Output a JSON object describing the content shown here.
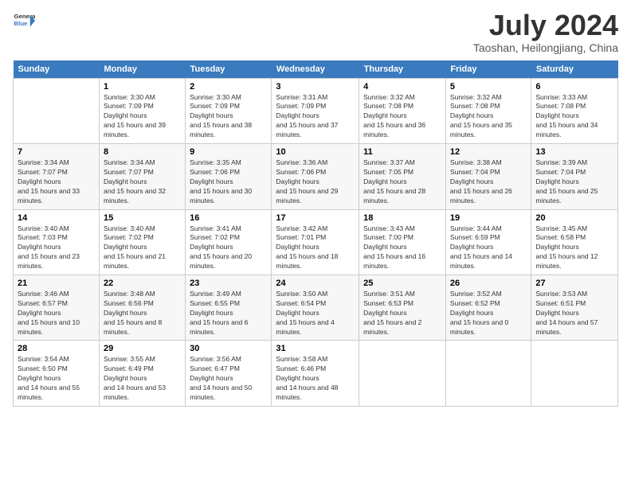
{
  "header": {
    "logo_line1": "General",
    "logo_line2": "Blue",
    "title": "July 2024",
    "subtitle": "Taoshan, Heilongjiang, China"
  },
  "weekdays": [
    "Sunday",
    "Monday",
    "Tuesday",
    "Wednesday",
    "Thursday",
    "Friday",
    "Saturday"
  ],
  "weeks": [
    [
      {
        "day": "",
        "sunrise": "",
        "sunset": "",
        "daylight": ""
      },
      {
        "day": "1",
        "sunrise": "3:30 AM",
        "sunset": "7:09 PM",
        "daylight": "15 hours and 39 minutes."
      },
      {
        "day": "2",
        "sunrise": "3:30 AM",
        "sunset": "7:09 PM",
        "daylight": "15 hours and 38 minutes."
      },
      {
        "day": "3",
        "sunrise": "3:31 AM",
        "sunset": "7:09 PM",
        "daylight": "15 hours and 37 minutes."
      },
      {
        "day": "4",
        "sunrise": "3:32 AM",
        "sunset": "7:08 PM",
        "daylight": "15 hours and 36 minutes."
      },
      {
        "day": "5",
        "sunrise": "3:32 AM",
        "sunset": "7:08 PM",
        "daylight": "15 hours and 35 minutes."
      },
      {
        "day": "6",
        "sunrise": "3:33 AM",
        "sunset": "7:08 PM",
        "daylight": "15 hours and 34 minutes."
      }
    ],
    [
      {
        "day": "7",
        "sunrise": "3:34 AM",
        "sunset": "7:07 PM",
        "daylight": "15 hours and 33 minutes."
      },
      {
        "day": "8",
        "sunrise": "3:34 AM",
        "sunset": "7:07 PM",
        "daylight": "15 hours and 32 minutes."
      },
      {
        "day": "9",
        "sunrise": "3:35 AM",
        "sunset": "7:06 PM",
        "daylight": "15 hours and 30 minutes."
      },
      {
        "day": "10",
        "sunrise": "3:36 AM",
        "sunset": "7:06 PM",
        "daylight": "15 hours and 29 minutes."
      },
      {
        "day": "11",
        "sunrise": "3:37 AM",
        "sunset": "7:05 PM",
        "daylight": "15 hours and 28 minutes."
      },
      {
        "day": "12",
        "sunrise": "3:38 AM",
        "sunset": "7:04 PM",
        "daylight": "15 hours and 26 minutes."
      },
      {
        "day": "13",
        "sunrise": "3:39 AM",
        "sunset": "7:04 PM",
        "daylight": "15 hours and 25 minutes."
      }
    ],
    [
      {
        "day": "14",
        "sunrise": "3:40 AM",
        "sunset": "7:03 PM",
        "daylight": "15 hours and 23 minutes."
      },
      {
        "day": "15",
        "sunrise": "3:40 AM",
        "sunset": "7:02 PM",
        "daylight": "15 hours and 21 minutes."
      },
      {
        "day": "16",
        "sunrise": "3:41 AM",
        "sunset": "7:02 PM",
        "daylight": "15 hours and 20 minutes."
      },
      {
        "day": "17",
        "sunrise": "3:42 AM",
        "sunset": "7:01 PM",
        "daylight": "15 hours and 18 minutes."
      },
      {
        "day": "18",
        "sunrise": "3:43 AM",
        "sunset": "7:00 PM",
        "daylight": "15 hours and 16 minutes."
      },
      {
        "day": "19",
        "sunrise": "3:44 AM",
        "sunset": "6:59 PM",
        "daylight": "15 hours and 14 minutes."
      },
      {
        "day": "20",
        "sunrise": "3:45 AM",
        "sunset": "6:58 PM",
        "daylight": "15 hours and 12 minutes."
      }
    ],
    [
      {
        "day": "21",
        "sunrise": "3:46 AM",
        "sunset": "6:57 PM",
        "daylight": "15 hours and 10 minutes."
      },
      {
        "day": "22",
        "sunrise": "3:48 AM",
        "sunset": "6:56 PM",
        "daylight": "15 hours and 8 minutes."
      },
      {
        "day": "23",
        "sunrise": "3:49 AM",
        "sunset": "6:55 PM",
        "daylight": "15 hours and 6 minutes."
      },
      {
        "day": "24",
        "sunrise": "3:50 AM",
        "sunset": "6:54 PM",
        "daylight": "15 hours and 4 minutes."
      },
      {
        "day": "25",
        "sunrise": "3:51 AM",
        "sunset": "6:53 PM",
        "daylight": "15 hours and 2 minutes."
      },
      {
        "day": "26",
        "sunrise": "3:52 AM",
        "sunset": "6:52 PM",
        "daylight": "15 hours and 0 minutes."
      },
      {
        "day": "27",
        "sunrise": "3:53 AM",
        "sunset": "6:51 PM",
        "daylight": "14 hours and 57 minutes."
      }
    ],
    [
      {
        "day": "28",
        "sunrise": "3:54 AM",
        "sunset": "6:50 PM",
        "daylight": "14 hours and 55 minutes."
      },
      {
        "day": "29",
        "sunrise": "3:55 AM",
        "sunset": "6:49 PM",
        "daylight": "14 hours and 53 minutes."
      },
      {
        "day": "30",
        "sunrise": "3:56 AM",
        "sunset": "6:47 PM",
        "daylight": "14 hours and 50 minutes."
      },
      {
        "day": "31",
        "sunrise": "3:58 AM",
        "sunset": "6:46 PM",
        "daylight": "14 hours and 48 minutes."
      },
      {
        "day": "",
        "sunrise": "",
        "sunset": "",
        "daylight": ""
      },
      {
        "day": "",
        "sunrise": "",
        "sunset": "",
        "daylight": ""
      },
      {
        "day": "",
        "sunrise": "",
        "sunset": "",
        "daylight": ""
      }
    ]
  ]
}
